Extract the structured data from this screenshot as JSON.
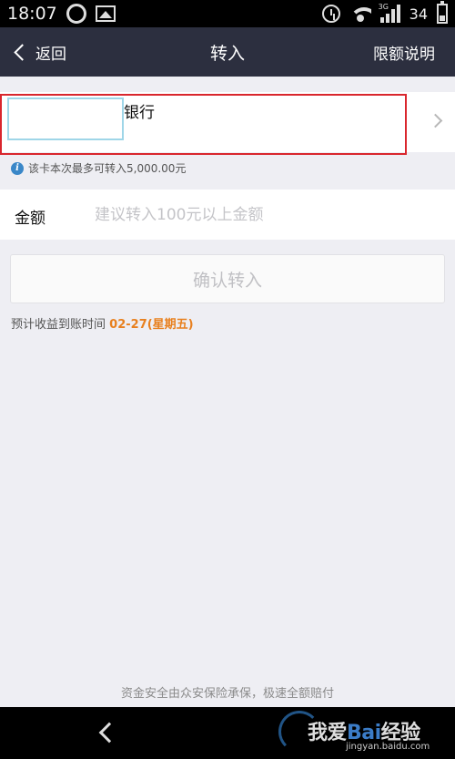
{
  "status_bar": {
    "time": "18:07",
    "signal_type": "3G",
    "battery": "34",
    "icons": [
      "sync-icon",
      "image-icon",
      "alarm-icon",
      "wifi-icon",
      "signal-icon",
      "battery-icon"
    ]
  },
  "header": {
    "back_label": "返回",
    "title": "转入",
    "limit_link": "限额说明"
  },
  "bank_card": {
    "name": "银行",
    "highlight_color": "#d9262d"
  },
  "limit_info": {
    "text": "该卡本次最多可转入5,000.00元"
  },
  "amount": {
    "label": "金额",
    "placeholder": "建议转入100元以上金额",
    "value": ""
  },
  "confirm": {
    "label": "确认转入"
  },
  "eta": {
    "prefix": "预计收益到账时间",
    "date": "02-27(星期五)",
    "accent_color": "#e8801e"
  },
  "footer": {
    "safety_note": "资金安全由众安保险承保，极速全额赔付"
  },
  "watermark": {
    "text_prefix": "我爱",
    "text_brand": "Bai",
    "text_suffix": "经验",
    "url": "jingyan.baidu.com"
  }
}
